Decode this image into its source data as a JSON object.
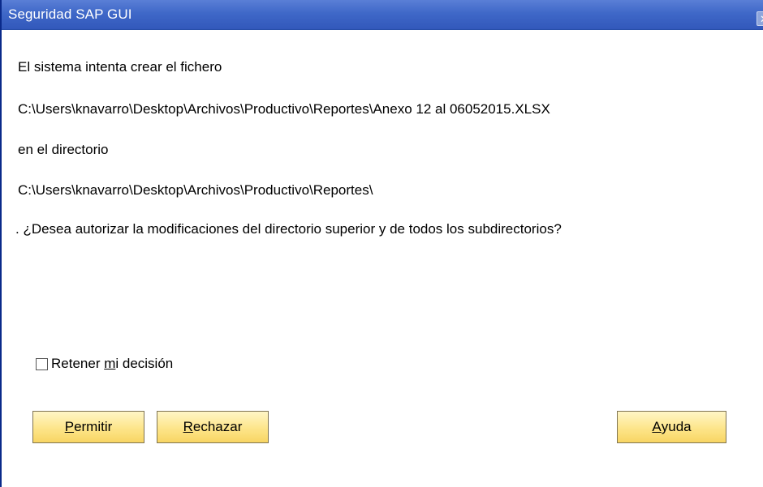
{
  "window": {
    "title": "Seguridad SAP GUI",
    "close_symbol": "✕"
  },
  "message": {
    "line1": "El sistema intenta crear el fichero",
    "file_path": "C:\\Users\\knavarro\\Desktop\\Archivos\\Productivo\\Reportes\\Anexo 12 al 06052015.XLSX",
    "line3": "en el directorio",
    "dir_path": "C:\\Users\\knavarro\\Desktop\\Archivos\\Productivo\\Reportes\\",
    "question": ". ¿Desea autorizar la modificaciones del directorio superior y de todos los subdirectorios?"
  },
  "remember": {
    "label_before": "Retener ",
    "label_mnemonic": "m",
    "label_after": "i decisión",
    "checked": false
  },
  "buttons": {
    "allow": {
      "mnemonic": "P",
      "rest": "ermitir"
    },
    "reject": {
      "mnemonic": "R",
      "rest": "echazar"
    },
    "help": {
      "mnemonic": "A",
      "rest": "yuda"
    }
  },
  "colors": {
    "titlebar": "#3f68c8",
    "button_fill": "#fde58a",
    "window_border": "#0a2a8a"
  }
}
